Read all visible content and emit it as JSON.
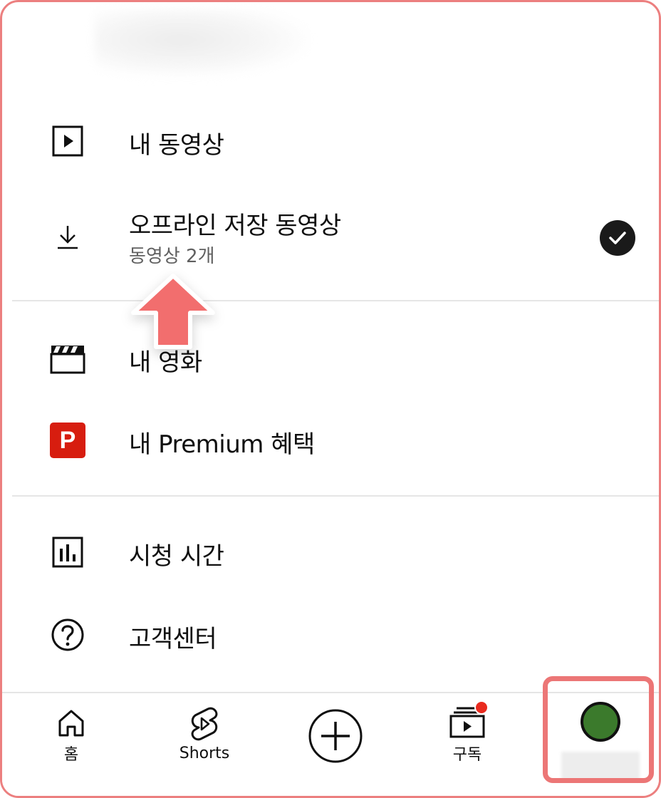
{
  "menu": {
    "items": [
      {
        "label": "내 동영상",
        "icon": "play-square-icon"
      },
      {
        "label": "오프라인 저장 동영상",
        "sub": "동영상 2개",
        "icon": "download-icon",
        "checked": true
      },
      {
        "label": "내 영화",
        "icon": "clapperboard-icon"
      },
      {
        "label": "내 Premium 혜택",
        "icon": "premium-p-icon",
        "badge_letter": "P"
      },
      {
        "label": "시청 시간",
        "icon": "bar-chart-icon"
      },
      {
        "label": "고객센터",
        "icon": "help-circle-icon"
      }
    ]
  },
  "nav": {
    "home_label": "홈",
    "shorts_label": "Shorts",
    "create_icon": "plus-circle-icon",
    "subscriptions_label": "구독",
    "profile_icon": "avatar"
  },
  "colors": {
    "premium_red": "#d71d0f",
    "annotation_red": "#ec7676",
    "avatar_green": "#3b7a2c",
    "notification_red": "#e92a1e"
  }
}
